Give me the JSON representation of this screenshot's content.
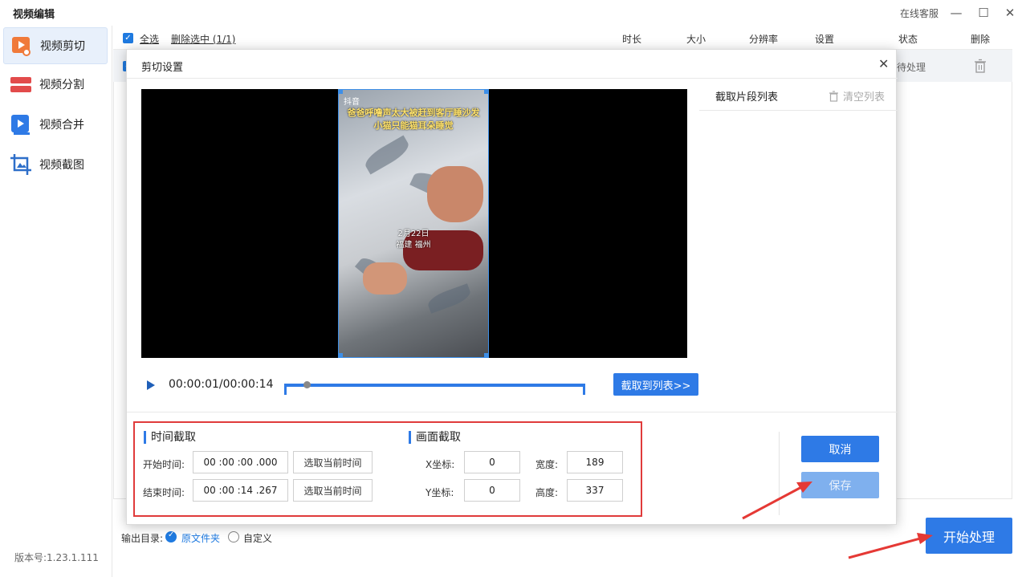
{
  "app": {
    "title": "视频编辑",
    "service_link": "在线客服",
    "version": "版本号:1.23.1.111"
  },
  "sidebar": {
    "items": [
      {
        "label": "视频剪切",
        "active": true
      },
      {
        "label": "视频分割",
        "active": false
      },
      {
        "label": "视频合并",
        "active": false
      },
      {
        "label": "视频截图",
        "active": false
      }
    ]
  },
  "list": {
    "select_all": "全选",
    "delete_selected": "删除选中 (1/1)",
    "columns": [
      "时长",
      "大小",
      "分辨率",
      "设置",
      "状态",
      "删除"
    ],
    "row_status": "待处理"
  },
  "output": {
    "label": "输出目录:",
    "option_original": "原文件夹",
    "option_custom": "自定义",
    "selected": "原文件夹"
  },
  "start_button": "开始处理",
  "modal": {
    "title": "剪切设置",
    "video": {
      "logo": "抖音",
      "caption_line1": "爸爸呼噜声太大被赶到客厅睡沙发",
      "caption_line2": "小猫只能猫耳朵睡觉",
      "date": "2月22日",
      "place": "福建 福州"
    },
    "time_display": "00:00:01/00:00:14",
    "playhead_position": 0.07,
    "add_to_list_button": "截取到列表>>",
    "segments_title": "截取片段列表",
    "clear_list": "清空列表",
    "time_section": {
      "title": "时间截取",
      "start_label": "开始时间:",
      "start_value": "00 :00 :00 .000",
      "end_label": "结束时间:",
      "end_value": "00 :00 :14 .267",
      "pick_current": "选取当前时间"
    },
    "frame_section": {
      "title": "画面截取",
      "x_label": "X坐标:",
      "x_value": "0",
      "y_label": "Y坐标:",
      "y_value": "0",
      "width_label": "宽度:",
      "width_value": "189",
      "height_label": "高度:",
      "height_value": "337"
    },
    "cancel_button": "取消",
    "save_button": "保存"
  },
  "colors": {
    "accent": "#2e7ae6",
    "highlight_box": "#e03b3b",
    "annotation_arrow": "#e53935"
  }
}
